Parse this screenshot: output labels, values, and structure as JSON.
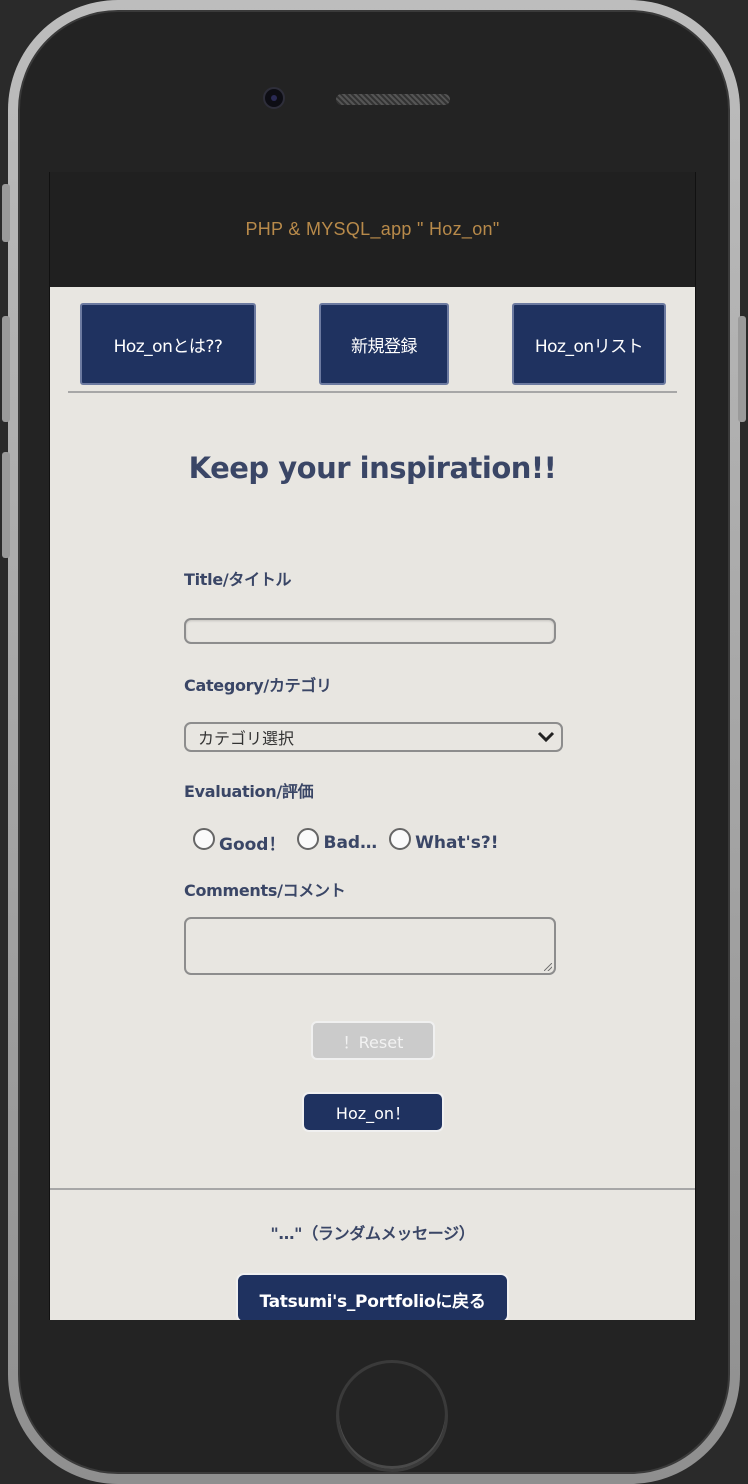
{
  "app": {
    "header_title": "PHP & MYSQL_app \" Hoz_on\""
  },
  "nav": {
    "about_label": "Hoz_onとは??",
    "register_label": "新規登録",
    "list_label": "Hoz_onリスト"
  },
  "main": {
    "heading": "Keep your inspiration!!"
  },
  "form": {
    "title_label": "Title/タイトル",
    "title_value": "",
    "category_label": "Category/カテゴリ",
    "category_selected": "カテゴリ選択",
    "evaluation_label": "Evaluation/評価",
    "evaluation_options": [
      "Good！",
      "Bad…",
      "What's?!"
    ],
    "comments_label": "Comments/コメント",
    "comments_value": "",
    "reset_label": "！Reset",
    "submit_label": "Hoz_on！"
  },
  "footer": {
    "random_message": "\"…\"（ランダムメッセージ）",
    "portfolio_label": "Tatsumi's_Portfolioに戻る"
  },
  "colors": {
    "header_bg": "#202020",
    "header_text": "#b88a4a",
    "primary": "#1f3260",
    "text": "#3a4666",
    "page_bg": "#e8e6e1",
    "reset_bg": "#cbcbcb"
  },
  "icons": {
    "select_arrow": "chevron-down-icon",
    "camera": "camera-icon",
    "speaker": "speaker-grille"
  }
}
